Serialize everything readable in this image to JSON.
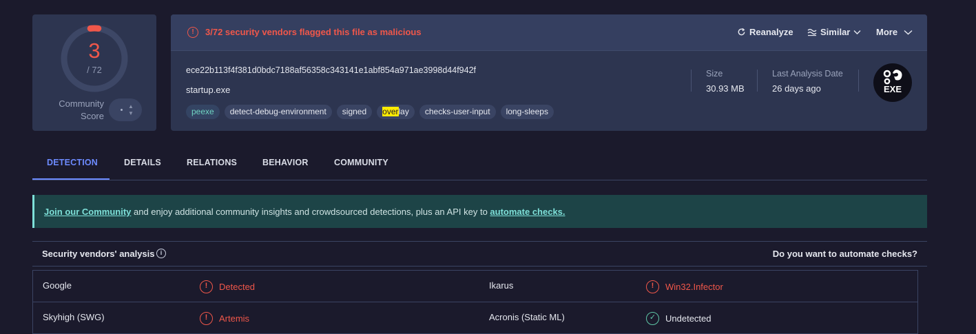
{
  "score": {
    "detections": "3",
    "total": "/ 72",
    "community_label_1": "Community",
    "community_label_2": "Score",
    "fraction": 0.0417
  },
  "alert": {
    "icon": "alert-circle-icon",
    "text": "3/72 security vendors flagged this file as malicious"
  },
  "actions": {
    "reanalyze": "Reanalyze",
    "similar": "Similar",
    "more": "More"
  },
  "file": {
    "hash": "ece22b113f4f381d0bdc7188af56358c343141e1abf854a971ae3998d44f942f",
    "name": "startup.exe",
    "tags": [
      "peexe",
      "detect-debug-environment",
      "signed",
      "overlay",
      "checks-user-input",
      "long-sleeps"
    ],
    "size_label": "Size",
    "size_value": "30.93 MB",
    "date_label": "Last Analysis Date",
    "date_value": "26 days ago",
    "type_badge": "EXE"
  },
  "tabs": [
    "DETECTION",
    "DETAILS",
    "RELATIONS",
    "BEHAVIOR",
    "COMMUNITY"
  ],
  "banner": {
    "link1": "Join our Community",
    "middle": " and enjoy additional community insights and crowdsourced detections, plus an API key to ",
    "link2": "automate checks."
  },
  "vendors": {
    "title": "Security vendors' analysis",
    "automate_question": "Do you want to automate checks?",
    "rows": [
      {
        "left_name": "Google",
        "left_result": "Detected",
        "left_status": "bad",
        "right_name": "Ikarus",
        "right_result": "Win32.Infector",
        "right_status": "bad"
      },
      {
        "left_name": "Skyhigh (SWG)",
        "left_result": "Artemis",
        "left_status": "bad",
        "right_name": "Acronis (Static ML)",
        "right_result": "Undetected",
        "right_status": "ok"
      }
    ]
  },
  "colors": {
    "malicious": "#f0574a",
    "accent": "#6d8bff",
    "undetected": "#5fc8a8",
    "banner_link": "#7ee0d9"
  }
}
